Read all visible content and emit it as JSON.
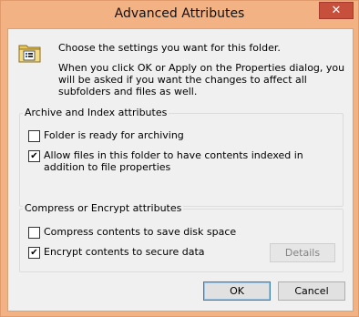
{
  "window": {
    "title": "Advanced Attributes",
    "close_glyph": "✕"
  },
  "intro": {
    "line1": "Choose the settings you want for this folder.",
    "line2": "When you click OK or Apply on the Properties dialog, you will be asked if you want the changes to affect all subfolders and files as well.",
    "icon": "folder-properties-icon"
  },
  "archive_group": {
    "title": "Archive and Index attributes",
    "options": [
      {
        "label": "Folder is ready for archiving",
        "checked": false
      },
      {
        "label": "Allow files in this folder to have contents indexed in addition to file properties",
        "checked": true
      }
    ]
  },
  "compress_group": {
    "title": "Compress or Encrypt attributes",
    "options": [
      {
        "label": "Compress contents to save disk space",
        "checked": false
      },
      {
        "label": "Encrypt contents to secure data",
        "checked": true
      }
    ],
    "details_label": "Details"
  },
  "buttons": {
    "ok": "OK",
    "cancel": "Cancel"
  },
  "colors": {
    "frame": "#f2b283",
    "close": "#c7503d",
    "client": "#f0f0f0"
  }
}
